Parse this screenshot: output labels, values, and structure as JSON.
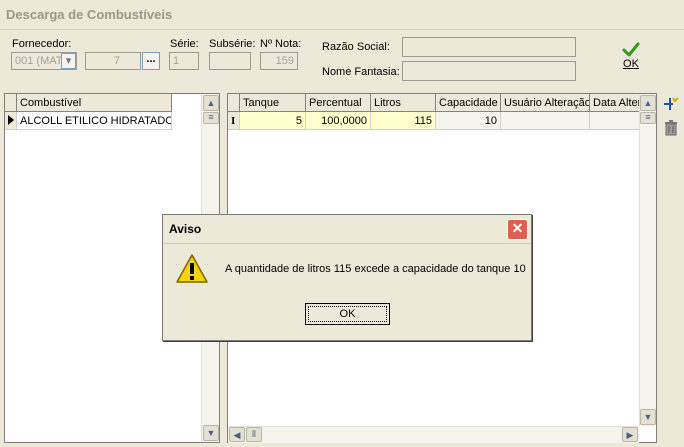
{
  "window": {
    "title": "Descarga de Combustíveis"
  },
  "header": {
    "fornecedor_label": "Fornecedor:",
    "fornecedor_code": "001 (MAT",
    "fornecedor_num": "7",
    "ellipsis": "...",
    "serie_label": "Série:",
    "serie_value": "1",
    "subserie_label": "Subsérie:",
    "subserie_value": "",
    "nota_label": "Nº Nota:",
    "nota_value": "159",
    "razao_label": "Razão Social:",
    "razao_value": "",
    "fantasia_label": "Nome Fantasia:",
    "fantasia_value": "",
    "ok_label": "OK"
  },
  "left_grid": {
    "column": "Combustível",
    "rows": [
      "ALCOLL ETILICO HIDRATADO"
    ]
  },
  "right_grid": {
    "columns": [
      "Tanque",
      "Percentual",
      "Litros",
      "Capacidade",
      "Usuário Alteração",
      "Data Alter"
    ],
    "row": {
      "tanque": "5",
      "percentual": "100,0000",
      "litros": "115",
      "capacidade": "10",
      "usuario": "",
      "data": ""
    }
  },
  "dialog": {
    "title": "Aviso",
    "message": "A quantidade de litros 115 excede a capacidade do tanque 10",
    "ok_label": "OK",
    "close_glyph": "✕"
  },
  "colors": {
    "highlight": "#ffffcc",
    "accent_blue": "#0a246a",
    "warning_yellow": "#f5d400"
  }
}
